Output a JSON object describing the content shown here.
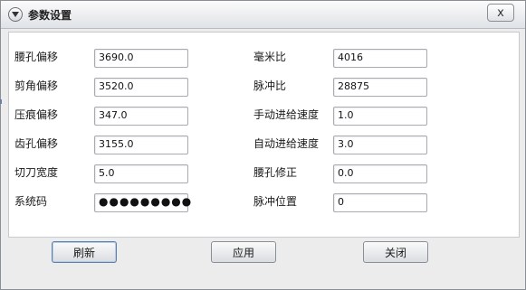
{
  "window": {
    "title": "参数设置",
    "close_label": "x"
  },
  "fields_left": [
    {
      "label": "腰孔偏移",
      "value": "3690.0"
    },
    {
      "label": "剪角偏移",
      "value": "3520.0"
    },
    {
      "label": "压痕偏移",
      "value": "347.0"
    },
    {
      "label": "齿孔偏移",
      "value": "3155.0"
    },
    {
      "label": "切刀宽度",
      "value": "5.0"
    },
    {
      "label": "系统码",
      "value": "●●●●●●●●●"
    }
  ],
  "fields_right": [
    {
      "label": "毫米比",
      "value": "4016"
    },
    {
      "label": "脉冲比",
      "value": "28875"
    },
    {
      "label": "手动进给速度",
      "value": "1.0"
    },
    {
      "label": "自动进给速度",
      "value": "3.0"
    },
    {
      "label": "腰孔修正",
      "value": "0.0"
    },
    {
      "label": "脉冲位置",
      "value": "0"
    }
  ],
  "buttons": {
    "refresh": "刷新",
    "apply": "应用",
    "close": "关闭"
  },
  "icons": {
    "title_menu": "chevron-down-icon",
    "close": "close-icon"
  }
}
